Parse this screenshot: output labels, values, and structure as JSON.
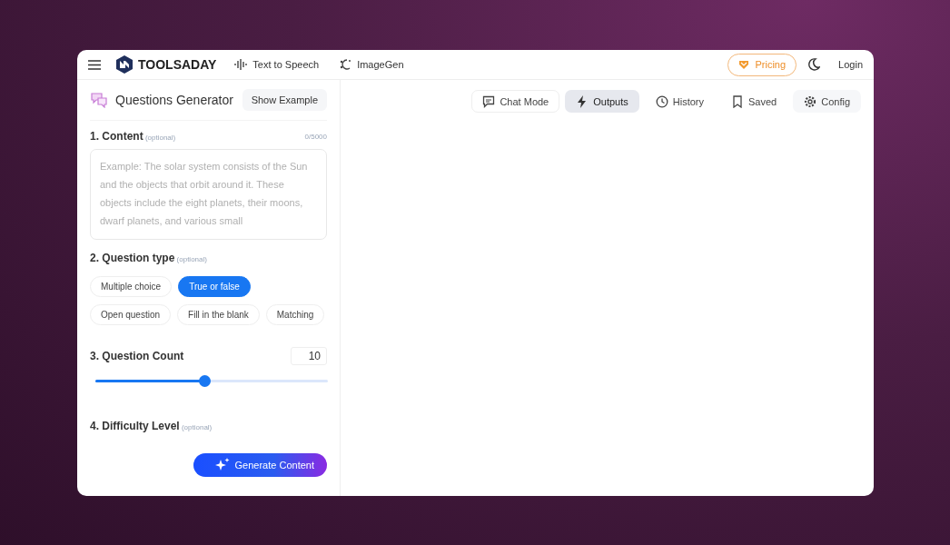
{
  "header": {
    "brand": "TOOLSADAY",
    "nav": [
      {
        "label": "Text to Speech"
      },
      {
        "label": "ImageGen"
      }
    ],
    "pricing": "Pricing",
    "login": "Login"
  },
  "tool": {
    "title": "Questions Generator",
    "example_button": "Show Example"
  },
  "content": {
    "label": "1. Content",
    "optional": "(optional)",
    "counter": "0/5000",
    "placeholder": "Example: The solar system consists of the Sun and the objects that orbit around it. These objects include the eight planets, their moons, dwarf planets, and various small"
  },
  "question_type": {
    "label": "2. Question type",
    "optional": "(optional)",
    "options": [
      {
        "label": "Multiple choice",
        "selected": false
      },
      {
        "label": "True or false",
        "selected": true
      },
      {
        "label": "Open question",
        "selected": false
      },
      {
        "label": "Fill in the blank",
        "selected": false
      },
      {
        "label": "Matching",
        "selected": false
      }
    ]
  },
  "question_count": {
    "label": "3. Question Count",
    "value": "10",
    "level": 0.47
  },
  "difficulty": {
    "label": "4. Difficulty Level",
    "optional": "(optional)"
  },
  "generate_button": "Generate Content",
  "output_tabs": [
    {
      "label": "Chat Mode",
      "kind": "outline",
      "selected": false
    },
    {
      "label": "Outputs",
      "kind": "plain",
      "selected": true
    },
    {
      "label": "History",
      "kind": "plain",
      "selected": false
    },
    {
      "label": "Saved",
      "kind": "plain",
      "selected": false
    },
    {
      "label": "Config",
      "kind": "soft",
      "selected": false
    }
  ]
}
